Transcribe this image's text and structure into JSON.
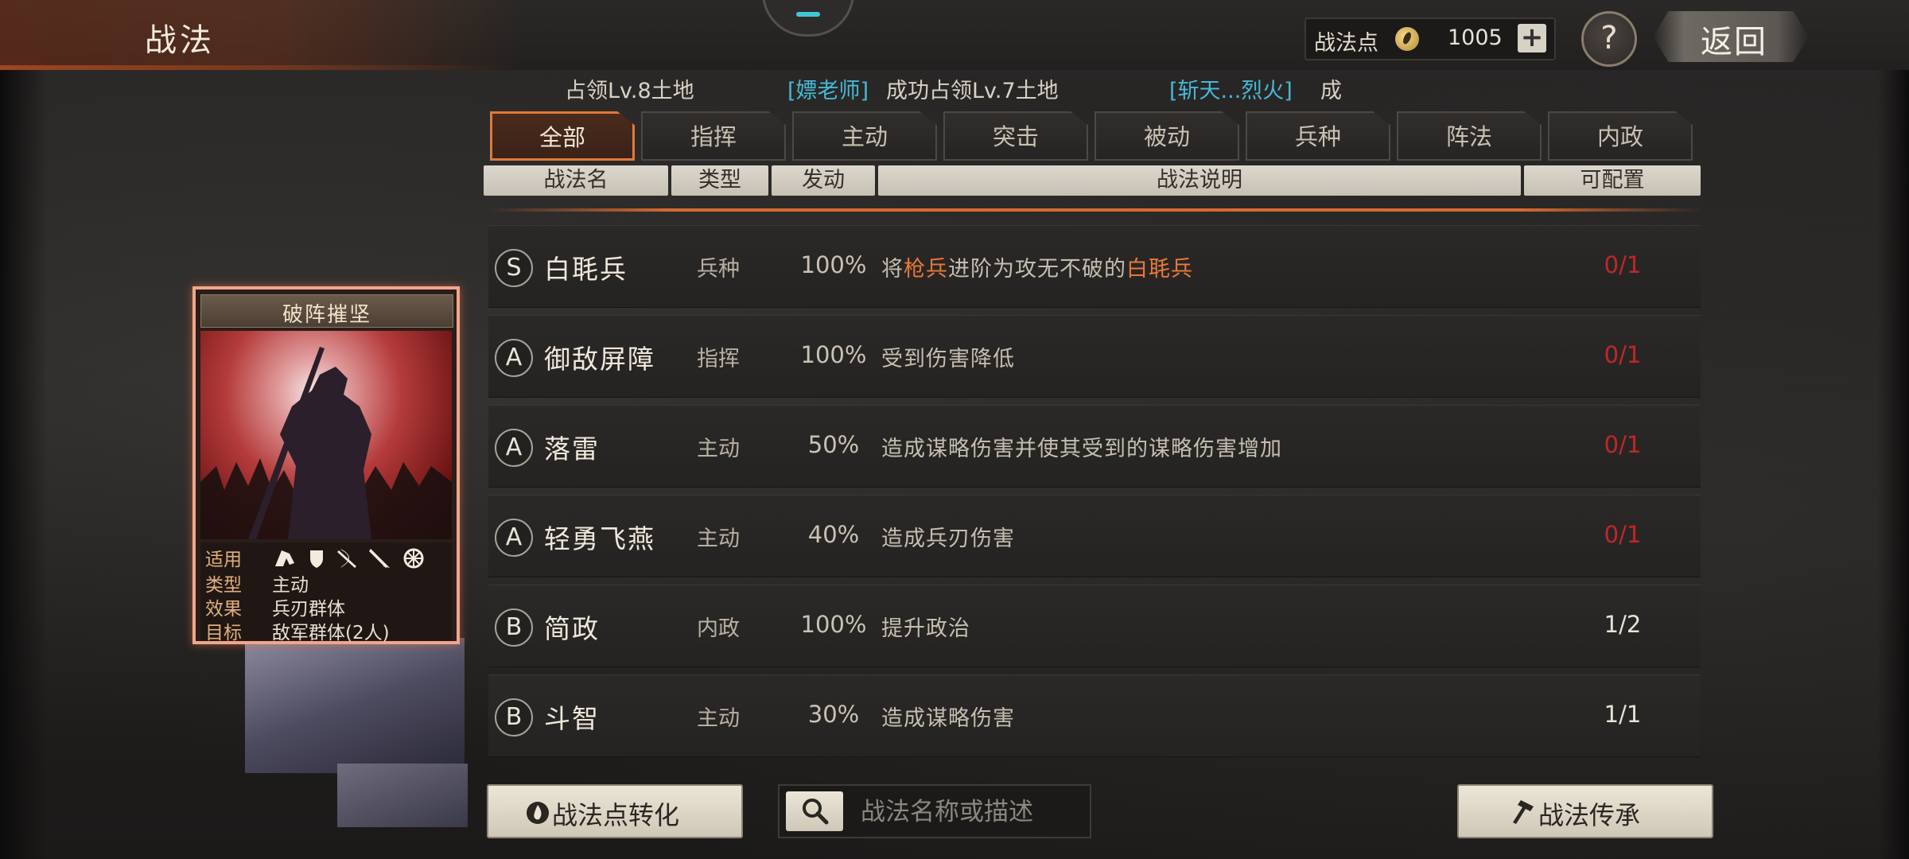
{
  "header": {
    "title": "战法",
    "points_label": "战法点",
    "points_value": "1005",
    "plus_label": "+",
    "help_label": "?",
    "back_label": "返回"
  },
  "ticker": {
    "prefix": "占领Lv.8土地",
    "name1": "[嫖老师]",
    "text1": "成功占领Lv.7土地",
    "name2": "[斩天...烈火]",
    "text2": "成"
  },
  "tabs": [
    "全部",
    "指挥",
    "主动",
    "突击",
    "被动",
    "兵种",
    "阵法",
    "内政"
  ],
  "columns": {
    "name": "战法名",
    "type": "类型",
    "trigger": "发动",
    "desc": "战法说明",
    "config": "可配置"
  },
  "rows": [
    {
      "grade": "S",
      "name": "白毦兵",
      "type": "兵种",
      "pct": "100%",
      "desc_parts": [
        "将",
        "枪兵",
        "进阶为攻无不破的",
        "白毦兵"
      ],
      "config": "0/1",
      "config_color": "#c0262a"
    },
    {
      "grade": "A",
      "name": "御敌屏障",
      "type": "指挥",
      "pct": "100%",
      "desc": "受到伤害降低",
      "config": "0/1",
      "config_color": "#c0262a"
    },
    {
      "grade": "A",
      "name": "落雷",
      "type": "主动",
      "pct": "50%",
      "desc": "造成谋略伤害并使其受到的谋略伤害增加",
      "config": "0/1",
      "config_color": "#c0262a"
    },
    {
      "grade": "A",
      "name": "轻勇飞燕",
      "type": "主动",
      "pct": "40%",
      "desc": "造成兵刃伤害",
      "config": "0/1",
      "config_color": "#c0262a"
    },
    {
      "grade": "B",
      "name": "简政",
      "type": "内政",
      "pct": "100%",
      "desc": "提升政治",
      "config": "1/2",
      "config_color": "#e8e2d6"
    },
    {
      "grade": "B",
      "name": "斗智",
      "type": "主动",
      "pct": "30%",
      "desc": "造成谋略伤害",
      "config": "1/1",
      "config_color": "#e8e2d6"
    }
  ],
  "card": {
    "title": "破阵摧坚",
    "apply_label": "适用",
    "type_label": "类型",
    "type_value": "主动",
    "effect_label": "效果",
    "effect_value": "兵刃群体",
    "target_label": "目标",
    "target_value": "敌军群体(2人)",
    "troop_icons": [
      "cavalry-icon",
      "shield-icon",
      "bow-icon",
      "spear-icon",
      "siege-icon"
    ]
  },
  "bottom": {
    "convert_label": "战法点转化",
    "search_placeholder": "战法名称或描述",
    "inherit_label": "战法传承"
  }
}
